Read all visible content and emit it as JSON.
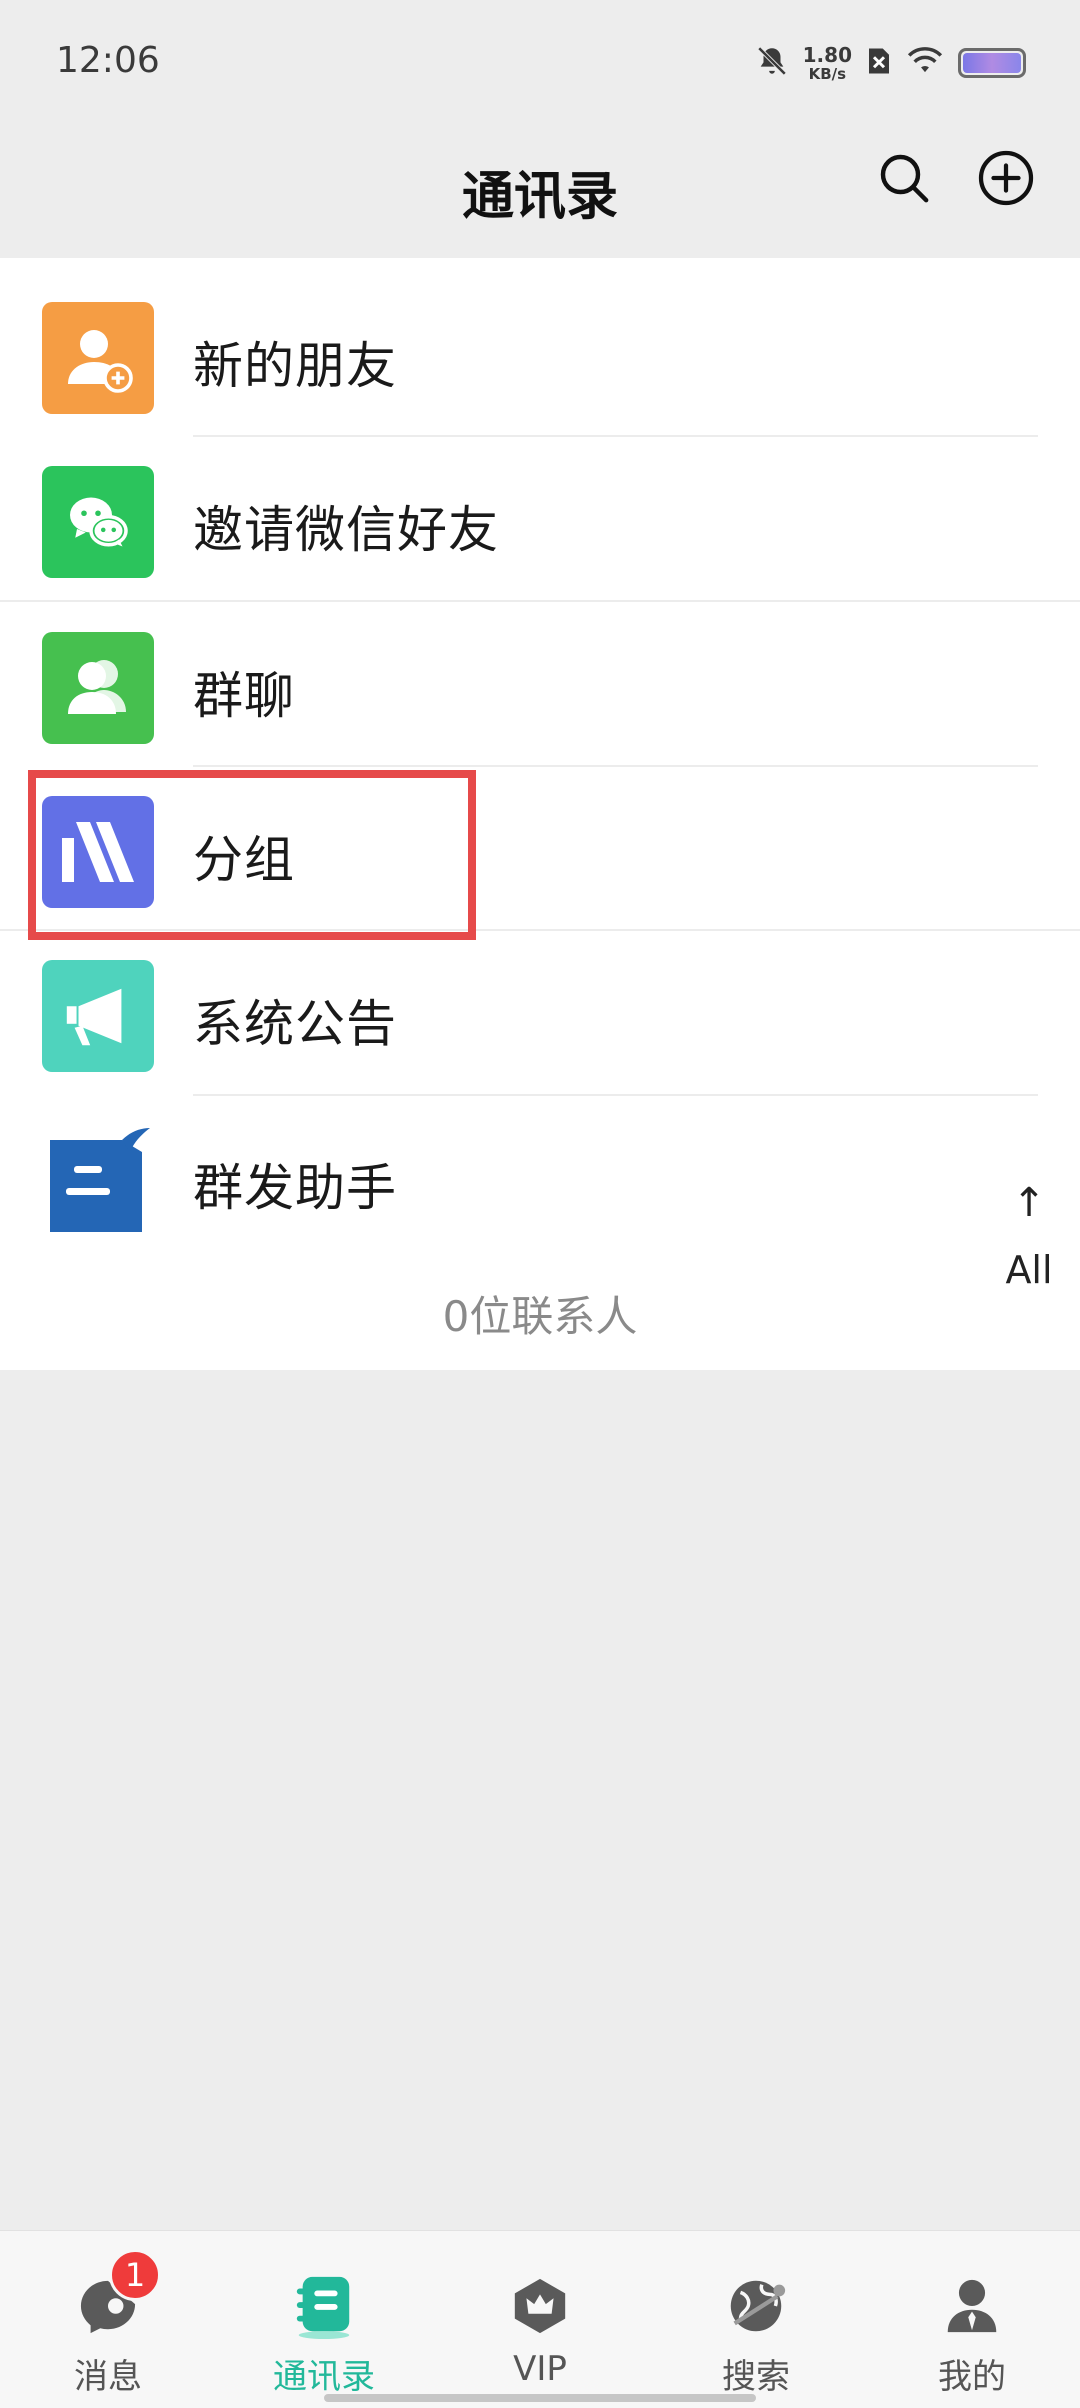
{
  "status_bar": {
    "time": "12:06",
    "net_speed_value": "1.80",
    "net_speed_unit": "KB/s",
    "icons": [
      "mute-bell-icon",
      "sim-blocked-icon",
      "wifi-icon",
      "battery-icon"
    ]
  },
  "header": {
    "title": "通讯录",
    "actions": [
      "search-icon",
      "add-circle-icon"
    ]
  },
  "list": {
    "items": [
      {
        "label": "新的朋友",
        "icon": "new-friend-icon",
        "color": "#f59d44"
      },
      {
        "label": "邀请微信好友",
        "icon": "wechat-icon",
        "color": "#2bc45c"
      },
      {
        "label": "群聊",
        "icon": "group-chat-icon",
        "color": "#46c04f"
      },
      {
        "label": "分组",
        "icon": "groups-icon",
        "color": "#6270e6"
      },
      {
        "label": "系统公告",
        "icon": "megaphone-icon",
        "color": "#4fd3bd"
      },
      {
        "label": "群发助手",
        "icon": "broadcast-assistant-icon",
        "color": "#2466b5"
      }
    ],
    "contact_count": "0位联系人"
  },
  "index_bar": {
    "arrow": "↑",
    "label": "All"
  },
  "highlight": {
    "target": "分组",
    "color": "#e64a4a"
  },
  "bottom_nav": {
    "items": [
      {
        "label": "消息",
        "icon": "message-icon",
        "badge": "1"
      },
      {
        "label": "通讯录",
        "icon": "contacts-icon",
        "active": true
      },
      {
        "label": "VIP",
        "icon": "vip-crown-icon"
      },
      {
        "label": "搜索",
        "icon": "explore-globe-icon"
      },
      {
        "label": "我的",
        "icon": "profile-icon"
      }
    ],
    "active_color": "#22b89a"
  }
}
